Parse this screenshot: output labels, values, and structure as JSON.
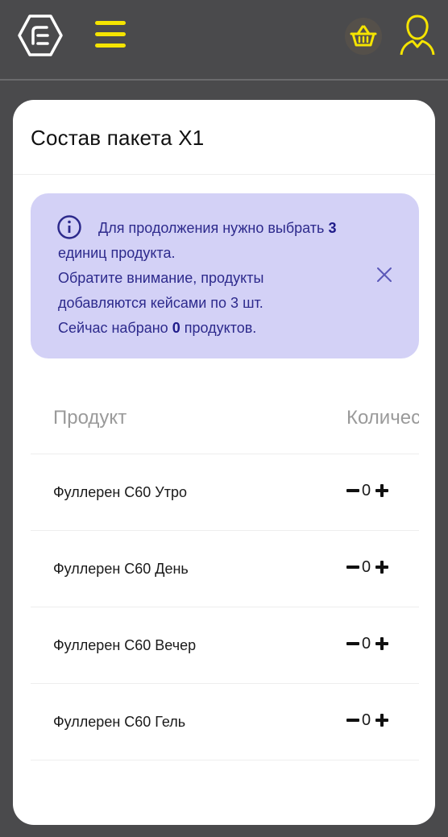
{
  "header": {
    "logo_icon": "hexagon-logo-icon",
    "menu_icon": "hamburger-menu-icon",
    "basket_icon": "basket-icon",
    "user_icon": "user-icon",
    "accent_color": "#f5e400"
  },
  "card": {
    "title": "Состав пакета X1"
  },
  "alert": {
    "line1_prefix": "Для продолжения нужно выбрать ",
    "required_count": "3",
    "line2": "единиц продукта.",
    "line3": "Обратите внимание, продукты",
    "line4": "добавляются кейсами по 3 шт.",
    "line5_prefix": "Сейчас набрано ",
    "selected_count": "0",
    "line5_suffix": " продуктов.",
    "background_color": "#d3d1f6"
  },
  "table": {
    "header_product": "Продукт",
    "header_quantity": "Количество",
    "rows": [
      {
        "name": "Фуллерен С60 Утро",
        "qty": "0"
      },
      {
        "name": "Фуллерен С60 День",
        "qty": "0"
      },
      {
        "name": "Фуллерен С60 Вечер",
        "qty": "0"
      },
      {
        "name": "Фуллерен С60 Гель",
        "qty": "0"
      }
    ]
  }
}
